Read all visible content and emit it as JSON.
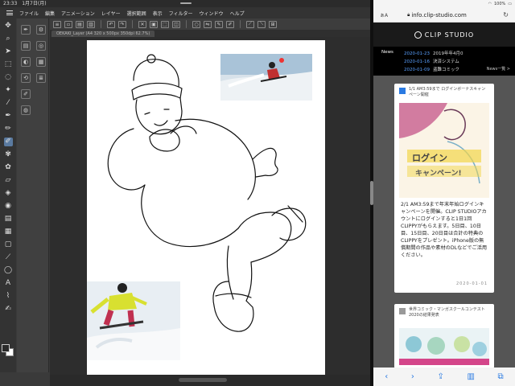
{
  "status": {
    "time": "23:33",
    "date": "1月7日(月)",
    "battery": "100%"
  },
  "menubar": {
    "items": [
      "ファイル",
      "編集",
      "アニメーション",
      "レイヤー",
      "選択範囲",
      "表示",
      "フィルター",
      "ウィンドウ",
      "ヘルプ"
    ]
  },
  "tab": {
    "label": "OEKAKI_Layer (A4 320 x 500px 350dpi 62.7%)"
  },
  "safari": {
    "url": "info.clip-studio.com",
    "aa_label": "ぁA",
    "brand": "CLIP STUDIO",
    "news_label": "News",
    "news": [
      {
        "date": "2020-01-23",
        "text": "2019年年4月0"
      },
      {
        "date": "2020-01-16",
        "text": "決済システム"
      },
      {
        "date": "2020-01-09",
        "text": "盗難コミック"
      }
    ],
    "news_more": "News一覧 >",
    "card1": {
      "title": "1/1 AM3:59まで ログインボーナスキャンペーン開催",
      "banner_line1": "ログイン",
      "banner_line2": "キャンペーン!",
      "body": "2/1 AM3:59まで年末年始ログインキャンペーンを開催。CLIP STUDIOアカウントにログインすると1日1回CLIPPYがもらえます。5日目、10日目、15日目、20日目は合計の特典のCLIPPYをプレゼント。iPhone版の無償期間の作品や素材のDLなどでご活用ください。",
      "date": "2020-01-01"
    },
    "card2": {
      "title": "世界コミック・マンガスクールコンテスト2020の結果発表"
    }
  },
  "colors": {
    "accent": "#2a7ae2",
    "news_date": "#5aa0ff",
    "card1_icon": "#2a7ae2",
    "card2_icon": "#999999"
  },
  "icons": [
    "hamburger-icon",
    "undo-icon",
    "redo-icon",
    "pen-icon",
    "eraser-icon",
    "move-icon",
    "zoom-icon",
    "eyedropper-icon",
    "fill-icon",
    "text-icon",
    "share-icon",
    "bookmarks-icon",
    "tabs-icon",
    "reload-icon",
    "lock-icon"
  ]
}
